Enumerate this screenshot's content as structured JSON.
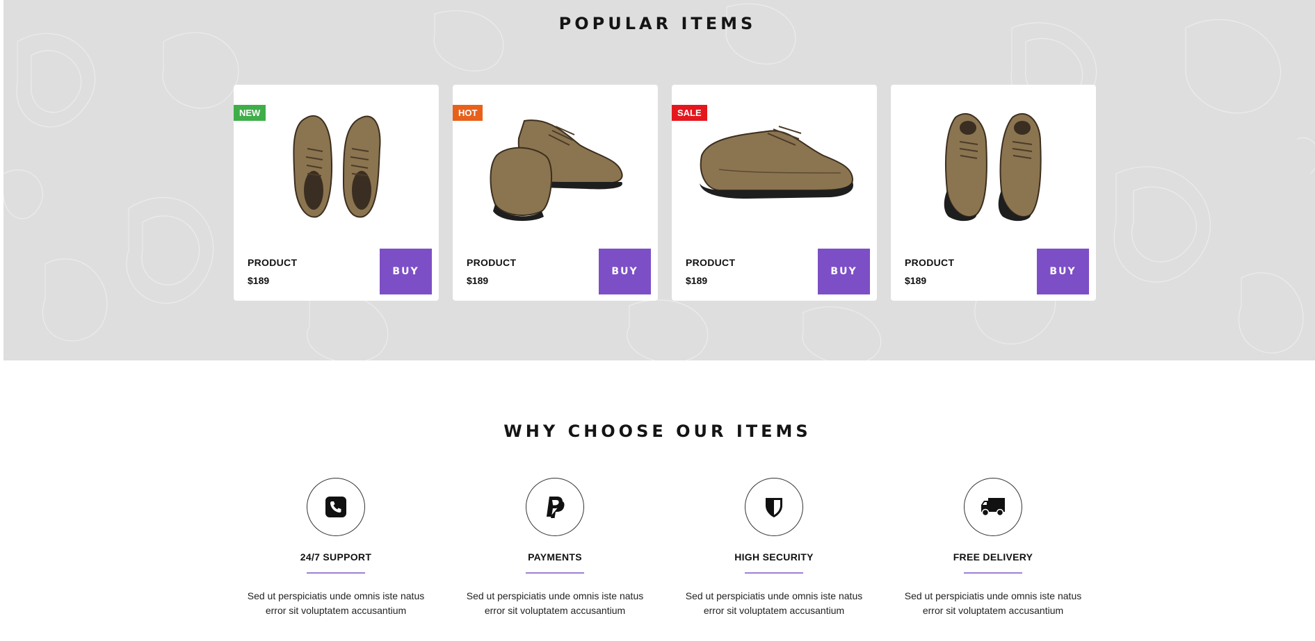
{
  "popular": {
    "title": "POPULAR ITEMS",
    "products": [
      {
        "badge": "NEW",
        "badge_color": "#3fae49",
        "name": "PRODUCT",
        "price": "$189",
        "buy_label": "BUY",
        "image": "shoes-top-view"
      },
      {
        "badge": "HOT",
        "badge_color": "#e8611b",
        "name": "PRODUCT",
        "price": "$189",
        "buy_label": "BUY",
        "image": "shoes-angled-pair"
      },
      {
        "badge": "SALE",
        "badge_color": "#e3171d",
        "name": "PRODUCT",
        "price": "$189",
        "buy_label": "BUY",
        "image": "shoe-side-view"
      },
      {
        "badge": "",
        "badge_color": "",
        "name": "PRODUCT",
        "price": "$189",
        "buy_label": "BUY",
        "image": "shoes-front-view"
      }
    ]
  },
  "why": {
    "title": "WHY CHOOSE OUR ITEMS",
    "features": [
      {
        "icon": "phone-icon",
        "title": "24/7 SUPPORT",
        "desc_line1": "Sed ut perspiciatis unde omnis iste natus",
        "desc_line2": "error sit voluptatem accusantium"
      },
      {
        "icon": "paypal-icon",
        "title": "PAYMENTS",
        "desc_line1": "Sed ut perspiciatis unde omnis iste natus",
        "desc_line2": "error sit voluptatem accusantium"
      },
      {
        "icon": "shield-icon",
        "title": "HIGH SECURITY",
        "desc_line1": "Sed ut perspiciatis unde omnis iste natus",
        "desc_line2": "error sit voluptatem accusantium"
      },
      {
        "icon": "truck-icon",
        "title": "FREE DELIVERY",
        "desc_line1": "Sed ut perspiciatis unde omnis iste natus",
        "desc_line2": "error sit voluptatem accusantium"
      }
    ]
  },
  "colors": {
    "accent": "#7d4fc6",
    "section_bg": "#dedede"
  }
}
